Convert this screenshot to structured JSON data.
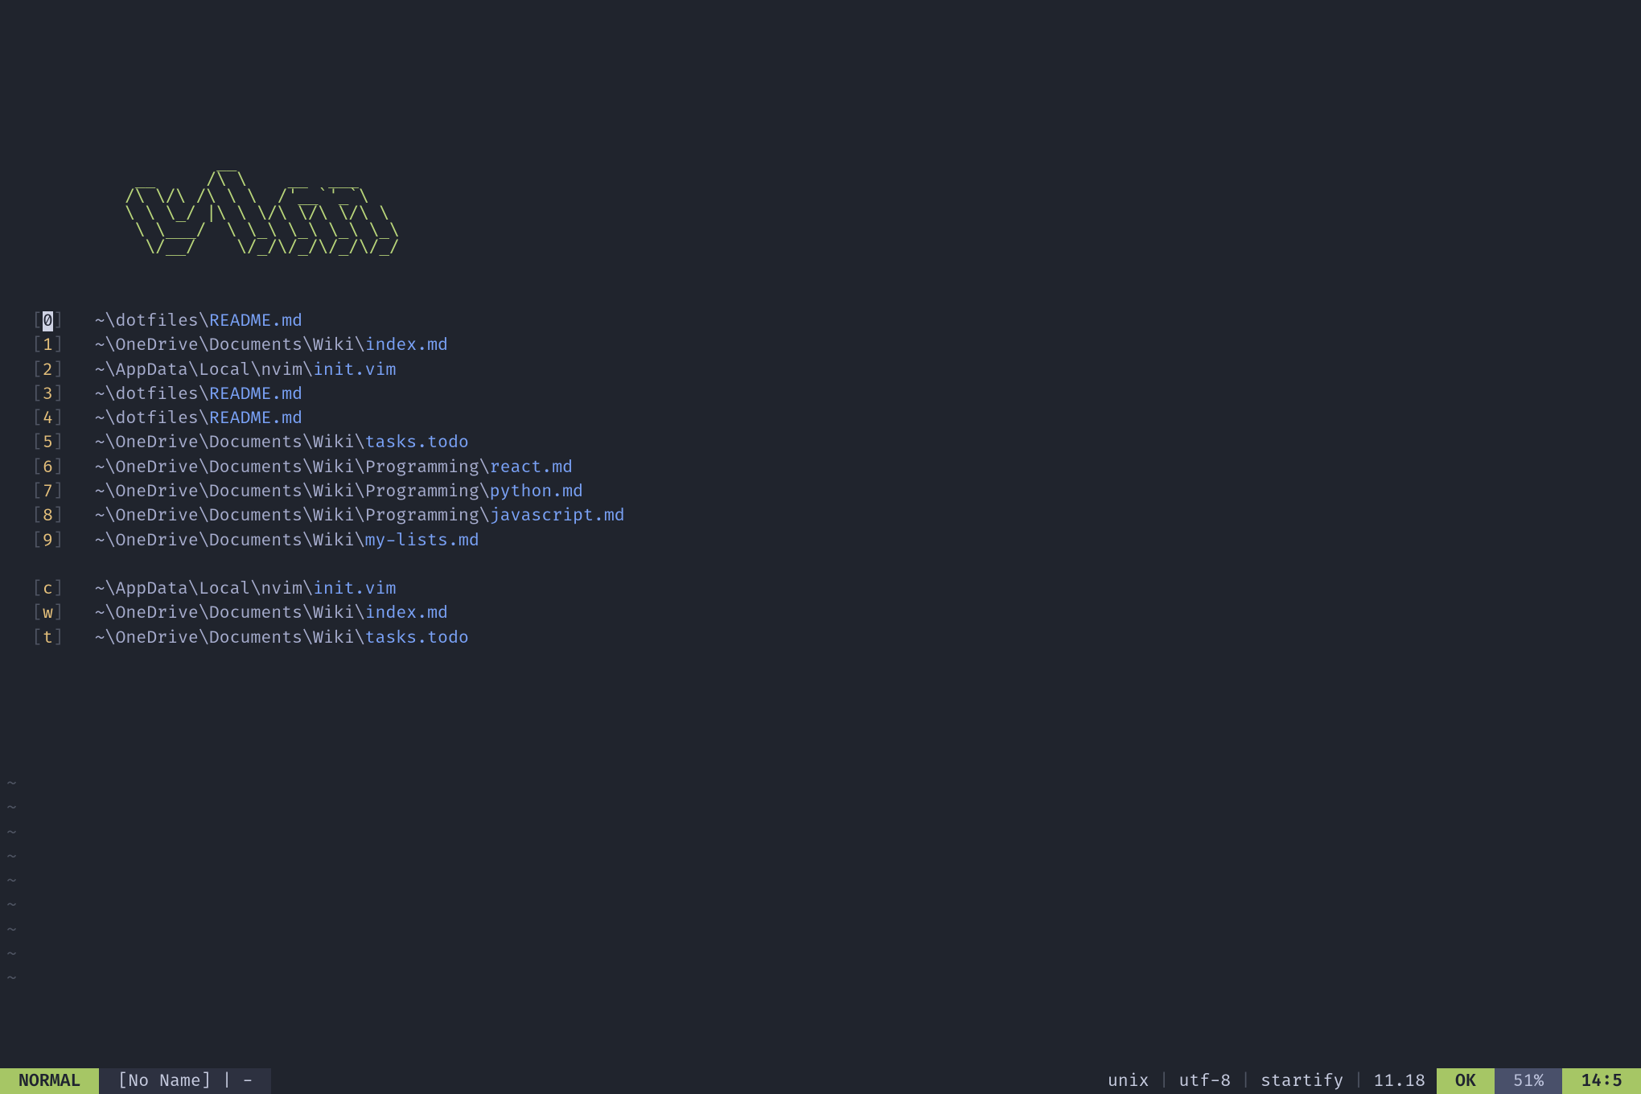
{
  "ascii_header": "           __\n   __     /\\ \\    __  ___\n  /\\ \\/\\ /\\ \\ \\  /'__`'_`\\\n  \\ \\ \\_/ |\\ \\ \\/\\ \\/\\ \\/\\ \\\n   \\ \\___/  \\ \\_\\ \\_\\ \\_\\ \\_\\\n    \\/__/    \\/_/\\/_/\\/_/\\/_/",
  "mru": [
    {
      "key": "0",
      "selected": true,
      "dir": "~\\dotfiles\\",
      "file": "README.md"
    },
    {
      "key": "1",
      "selected": false,
      "dir": "~\\OneDrive\\Documents\\Wiki\\",
      "file": "index.md"
    },
    {
      "key": "2",
      "selected": false,
      "dir": "~\\AppData\\Local\\nvim\\",
      "file": "init.vim"
    },
    {
      "key": "3",
      "selected": false,
      "dir": "~\\dotfiles\\",
      "file": "README.md"
    },
    {
      "key": "4",
      "selected": false,
      "dir": "~\\dotfiles\\",
      "file": "README.md"
    },
    {
      "key": "5",
      "selected": false,
      "dir": "~\\OneDrive\\Documents\\Wiki\\",
      "file": "tasks.todo"
    },
    {
      "key": "6",
      "selected": false,
      "dir": "~\\OneDrive\\Documents\\Wiki\\Programming\\",
      "file": "react.md"
    },
    {
      "key": "7",
      "selected": false,
      "dir": "~\\OneDrive\\Documents\\Wiki\\Programming\\",
      "file": "python.md"
    },
    {
      "key": "8",
      "selected": false,
      "dir": "~\\OneDrive\\Documents\\Wiki\\Programming\\",
      "file": "javascript.md"
    },
    {
      "key": "9",
      "selected": false,
      "dir": "~\\OneDrive\\Documents\\Wiki\\",
      "file": "my-lists.md"
    }
  ],
  "bookmarks": [
    {
      "key": "c",
      "dir": "~\\AppData\\Local\\nvim\\",
      "file": "init.vim"
    },
    {
      "key": "w",
      "dir": "~\\OneDrive\\Documents\\Wiki\\",
      "file": "index.md"
    },
    {
      "key": "t",
      "dir": "~\\OneDrive\\Documents\\Wiki\\",
      "file": "tasks.todo"
    }
  ],
  "tilde_count": 9,
  "status": {
    "mode": "NORMAL",
    "buffer": "[No Name]",
    "modified": "-",
    "fileformat": "unix",
    "encoding": "utf-8",
    "filetype": "startify",
    "timing": "11.18",
    "coc": "OK",
    "percent": "51%",
    "pos": "14:5"
  }
}
